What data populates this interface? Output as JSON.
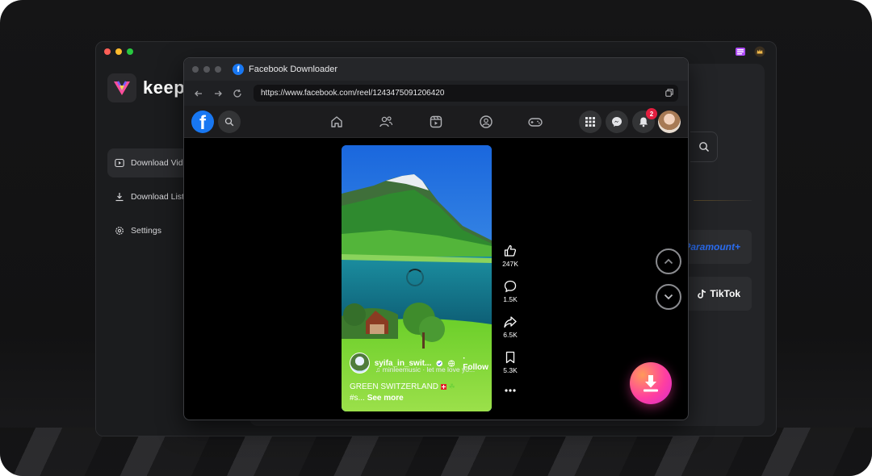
{
  "app": {
    "logo_text": "keepr",
    "sidebar": [
      {
        "label": "Download Vid",
        "icon": "play-icon",
        "active": true
      },
      {
        "label": "Download List",
        "icon": "download-icon",
        "active": false
      },
      {
        "label": "Settings",
        "icon": "gear-icon",
        "active": false
      }
    ],
    "sites": [
      {
        "label": "Paramount+",
        "brand_color": "#2a6cf0"
      },
      {
        "label": "TikTok",
        "brand_color": "#ffffff"
      }
    ]
  },
  "browser": {
    "title": "Facebook Downloader",
    "url": "https://www.facebook.com/reel/1243475091206420"
  },
  "facebook": {
    "notification_count": "2"
  },
  "reel": {
    "username": "syifa_in_swit...",
    "follow_label": "· Follow",
    "music": "♫ minleemusic · let me love yo...",
    "caption_line1": "GREEN SWITZERLAND",
    "caption_line2_prefix": "#s...",
    "see_more": "See more",
    "likes": "247K",
    "comments": "1.5K",
    "shares": "6.5K",
    "saves": "5.3K"
  },
  "colors": {
    "accent_facebook": "#1877f2",
    "badge_red": "#e41e3f",
    "download_gradient_start": "#ff9a5a",
    "download_gradient_end": "#d62ad0"
  }
}
